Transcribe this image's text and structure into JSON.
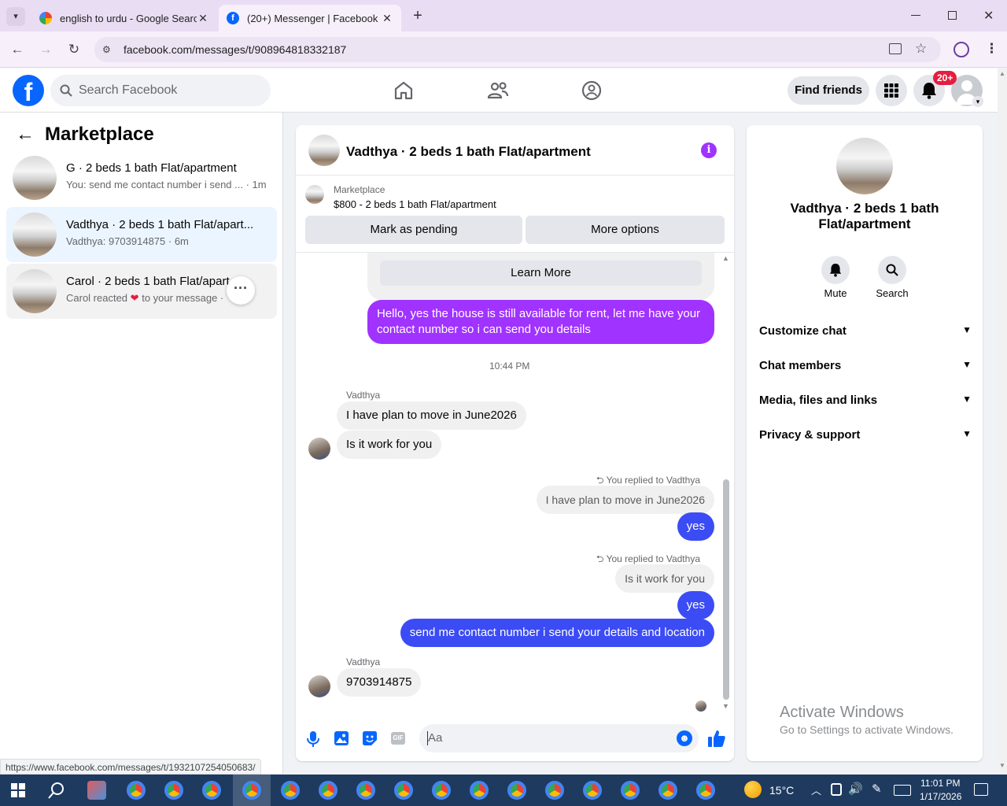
{
  "browser": {
    "tabs": [
      {
        "title": "english to urdu - Google Search",
        "active": false
      },
      {
        "title": "(20+) Messenger | Facebook",
        "active": true
      }
    ],
    "url": "facebook.com/messages/t/908964818332187",
    "status_url": "https://www.facebook.com/messages/t/1932107254050683/"
  },
  "fb_header": {
    "logo": "f",
    "search_placeholder": "Search Facebook",
    "find_friends": "Find friends",
    "notification_badge": "20+"
  },
  "sidebar": {
    "title": "Marketplace",
    "conversations": [
      {
        "name": "G · 2 beds 1 bath Flat/apartment",
        "preview": "You: send me contact number i send ... · 1m",
        "selected": false
      },
      {
        "name": "Vadthya · 2 beds 1 bath Flat/apart...",
        "preview": "Vadthya: 9703914875 · 6m",
        "selected": true
      },
      {
        "name": "Carol · 2 beds 1 bath Flat/apart...t",
        "preview": "Carol reacted",
        "preview_tail": "to your message · ...",
        "selected": false
      }
    ]
  },
  "chat": {
    "title": "Vadthya · 2 beds 1 bath Flat/apartment",
    "listing_label": "Marketplace",
    "listing_detail": "$800 - 2 beds 1 bath Flat/apartment",
    "mark_pending": "Mark as pending",
    "more_options": "More options",
    "learn_more": "Learn More",
    "messages": {
      "m1": "Hello, yes the house is still available for rent, let me have your contact number so i can send you details",
      "timestamp": "10:44 PM",
      "sender1": "Vadthya",
      "m2": "I have plan to move in June2026",
      "m3": "Is it work for you",
      "reply1_label": "You replied to Vadthya",
      "reply1_quote": "I have plan to move in June2026",
      "reply1_text": "yes",
      "reply2_label": "You replied to Vadthya",
      "reply2_quote": "Is it work for you",
      "reply2_text": "yes",
      "m4": "send me contact number i send your details and location",
      "sender2": "Vadthya",
      "m5": "9703914875"
    },
    "composer_placeholder": "Aa"
  },
  "info_panel": {
    "name": "Vadthya · 2 beds 1 bath Flat/apartment",
    "mute": "Mute",
    "search": "Search",
    "sections": [
      "Customize chat",
      "Chat members",
      "Media, files and links",
      "Privacy & support"
    ]
  },
  "watermark": {
    "title": "Activate Windows",
    "subtitle": "Go to Settings to activate Windows."
  },
  "taskbar": {
    "weather": "15°C",
    "time": "11:01 PM",
    "date": "1/17/2026"
  },
  "colors": {
    "fb_blue": "#0866ff",
    "outgoing": "#5c3bfe",
    "outgoing_purple": "#a033ff",
    "selected_conv": "#ebf5ff"
  }
}
